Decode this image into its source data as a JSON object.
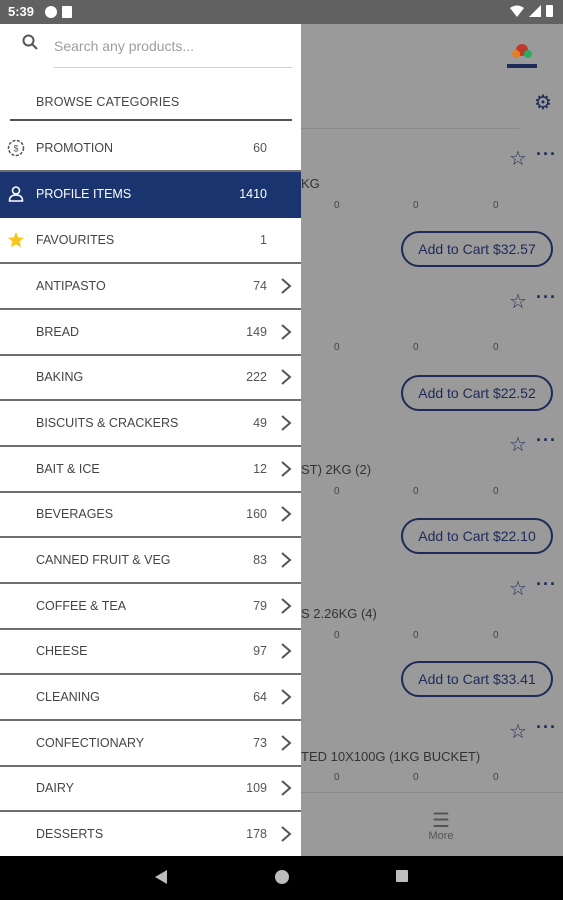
{
  "status_bar": {
    "time": "5:39"
  },
  "search": {
    "placeholder": "Search any products..."
  },
  "browse": {
    "title": "BROWSE CATEGORIES"
  },
  "special_items": [
    {
      "label": "PROMOTION",
      "count": "60",
      "icon": "promotion-badge-icon"
    },
    {
      "label": "PROFILE ITEMS",
      "count": "1410",
      "icon": "person-icon",
      "active": true
    },
    {
      "label": "FAVOURITES",
      "count": "1",
      "icon": "star-icon"
    }
  ],
  "categories": [
    {
      "label": "ANTIPASTO",
      "count": "74"
    },
    {
      "label": "BREAD",
      "count": "149"
    },
    {
      "label": "BAKING",
      "count": "222"
    },
    {
      "label": "BISCUITS & CRACKERS",
      "count": "49"
    },
    {
      "label": "BAIT & ICE",
      "count": "12"
    },
    {
      "label": "BEVERAGES",
      "count": "160"
    },
    {
      "label": "CANNED FRUIT & VEG",
      "count": "83"
    },
    {
      "label": "COFFEE & TEA",
      "count": "79"
    },
    {
      "label": "CHEESE",
      "count": "97"
    },
    {
      "label": "CLEANING",
      "count": "64"
    },
    {
      "label": "CONFECTIONARY",
      "count": "73"
    },
    {
      "label": "DAIRY",
      "count": "109"
    },
    {
      "label": "DESSERTS",
      "count": "178"
    }
  ],
  "background": {
    "products": [
      {
        "name_fragment": "KG",
        "zero": "0",
        "cart": "Add to Cart $32.57"
      },
      {
        "name_fragment": "",
        "zero": "0",
        "cart": "Add to Cart $22.52"
      },
      {
        "name_fragment": "ST) 2KG (2)",
        "zero": "0",
        "cart": "Add to Cart $22.10"
      },
      {
        "name_fragment": "S 2.26KG (4)",
        "zero": "0",
        "cart": "Add to Cart $33.41"
      },
      {
        "name_fragment": "TED 10X100G (1KG BUCKET)",
        "zero": "0"
      }
    ],
    "more_label": "More"
  },
  "colors": {
    "accent": "#1a3470",
    "star": "#f5c518"
  }
}
